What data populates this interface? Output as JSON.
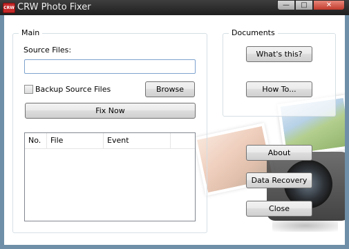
{
  "window": {
    "title": "CRW Photo Fixer",
    "app_icon_text": "CRW",
    "controls": {
      "minimize": "—",
      "maximize": "□",
      "close": "✕"
    }
  },
  "main_group": {
    "label": "Main",
    "source_files_label": "Source Files:",
    "source_files_value": "",
    "backup_checkbox": {
      "label": "Backup Source Files",
      "checked": false
    },
    "browse_button": "Browse",
    "fix_now_button": "Fix Now",
    "list": {
      "columns": [
        "No.",
        "File",
        "Event",
        ""
      ],
      "rows": []
    }
  },
  "documents_group": {
    "label": "Documents",
    "whats_this_button": "What's this?",
    "how_to_button": "How To..."
  },
  "side_buttons": {
    "about": "About",
    "data_recovery": "Data Recovery",
    "close": "Close"
  },
  "colors": {
    "title_bar": "#2b2b2b",
    "input_border": "#7da2ce",
    "close_button": "#c0392b"
  }
}
